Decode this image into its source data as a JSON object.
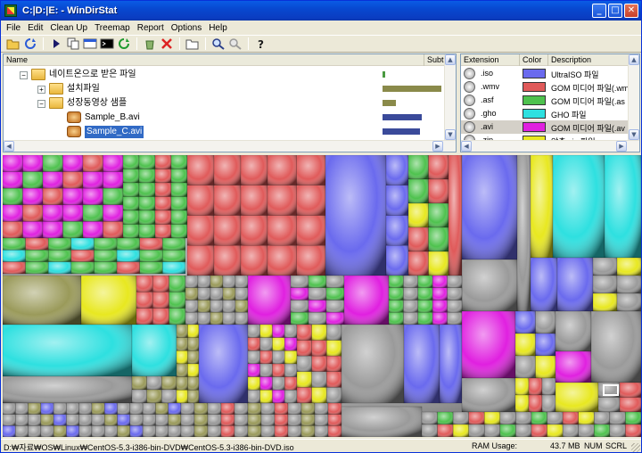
{
  "window": {
    "title": "C:|D:|E: - WinDirStat"
  },
  "menu": [
    "File",
    "Edit",
    "Clean Up",
    "Treemap",
    "Report",
    "Options",
    "Help"
  ],
  "toolbar_icons": [
    "open-folder-icon",
    "refresh-all-icon",
    "play-icon",
    "copy-path-icon",
    "explorer-icon",
    "command-prompt-icon",
    "refresh-icon",
    "recycle-icon",
    "delete-icon",
    "new-folder-icon",
    "zoom-in-icon",
    "zoom-out-icon",
    "help-icon"
  ],
  "tree": {
    "columns": [
      "Name",
      "Subtr"
    ],
    "rows": [
      {
        "label": "네이트온으로 받은 파일",
        "depth": 0,
        "expander": "−",
        "icon": "folder-icon",
        "bar_fraction": 0.05,
        "bar_color": "#4a9a40",
        "selected": false
      },
      {
        "label": "설치파일",
        "depth": 1,
        "expander": "+",
        "icon": "folder-icon",
        "bar_fraction": 0.97,
        "bar_color": "#8a8a4a",
        "selected": false
      },
      {
        "label": "성장동영상 샘플",
        "depth": 1,
        "expander": "−",
        "icon": "folder-icon",
        "bar_fraction": 0.22,
        "bar_color": "#8a8a4a",
        "selected": false
      },
      {
        "label": "Sample_B.avi",
        "depth": 2,
        "expander": "",
        "icon": "avi-icon",
        "bar_fraction": 0.64,
        "bar_color": "#3a4a9a",
        "selected": false
      },
      {
        "label": "Sample_C.avi",
        "depth": 2,
        "expander": "",
        "icon": "avi-icon",
        "bar_fraction": 0.62,
        "bar_color": "#3a4a9a",
        "selected": true
      }
    ]
  },
  "extensions": {
    "columns": [
      "Extension",
      "Color",
      "Description"
    ],
    "rows": [
      {
        "ext": ".iso",
        "color": "#6a6aee",
        "desc": "UltraISO 파일",
        "selected": false
      },
      {
        "ext": ".wmv",
        "color": "#e05a5a",
        "desc": "GOM 미디어 파일(.wm",
        "selected": false
      },
      {
        "ext": ".asf",
        "color": "#4ec24e",
        "desc": "GOM 미디어 파일(.as",
        "selected": false
      },
      {
        "ext": ".gho",
        "color": "#2ee0e0",
        "desc": "GHO 파일",
        "selected": false
      },
      {
        "ext": ".avi",
        "color": "#e020e0",
        "desc": "GOM 미디어 파일(.av",
        "selected": true
      },
      {
        "ext": ".zip",
        "color": "#e8e820",
        "desc": "압축 zip 파일",
        "selected": false
      }
    ]
  },
  "status": {
    "path": "D:₩자료₩OS₩Linux₩CentOS-5.3-i386-bin-DVD₩CentOS-5.3-i386-bin-DVD.iso",
    "ram_label": "RAM Usage:",
    "ram_value": "43.7 MB",
    "num": "NUM",
    "scrl": "SCRL"
  },
  "treemap_colors": {
    "iso": "#6a6aee",
    "wmv": "#e05a5a",
    "asf": "#4ec24e",
    "gho": "#2ee0e0",
    "avi": "#e020e0",
    "zip": "#e8e820",
    "other": "#9a9a9a",
    "olive": "#9a9a5a"
  }
}
